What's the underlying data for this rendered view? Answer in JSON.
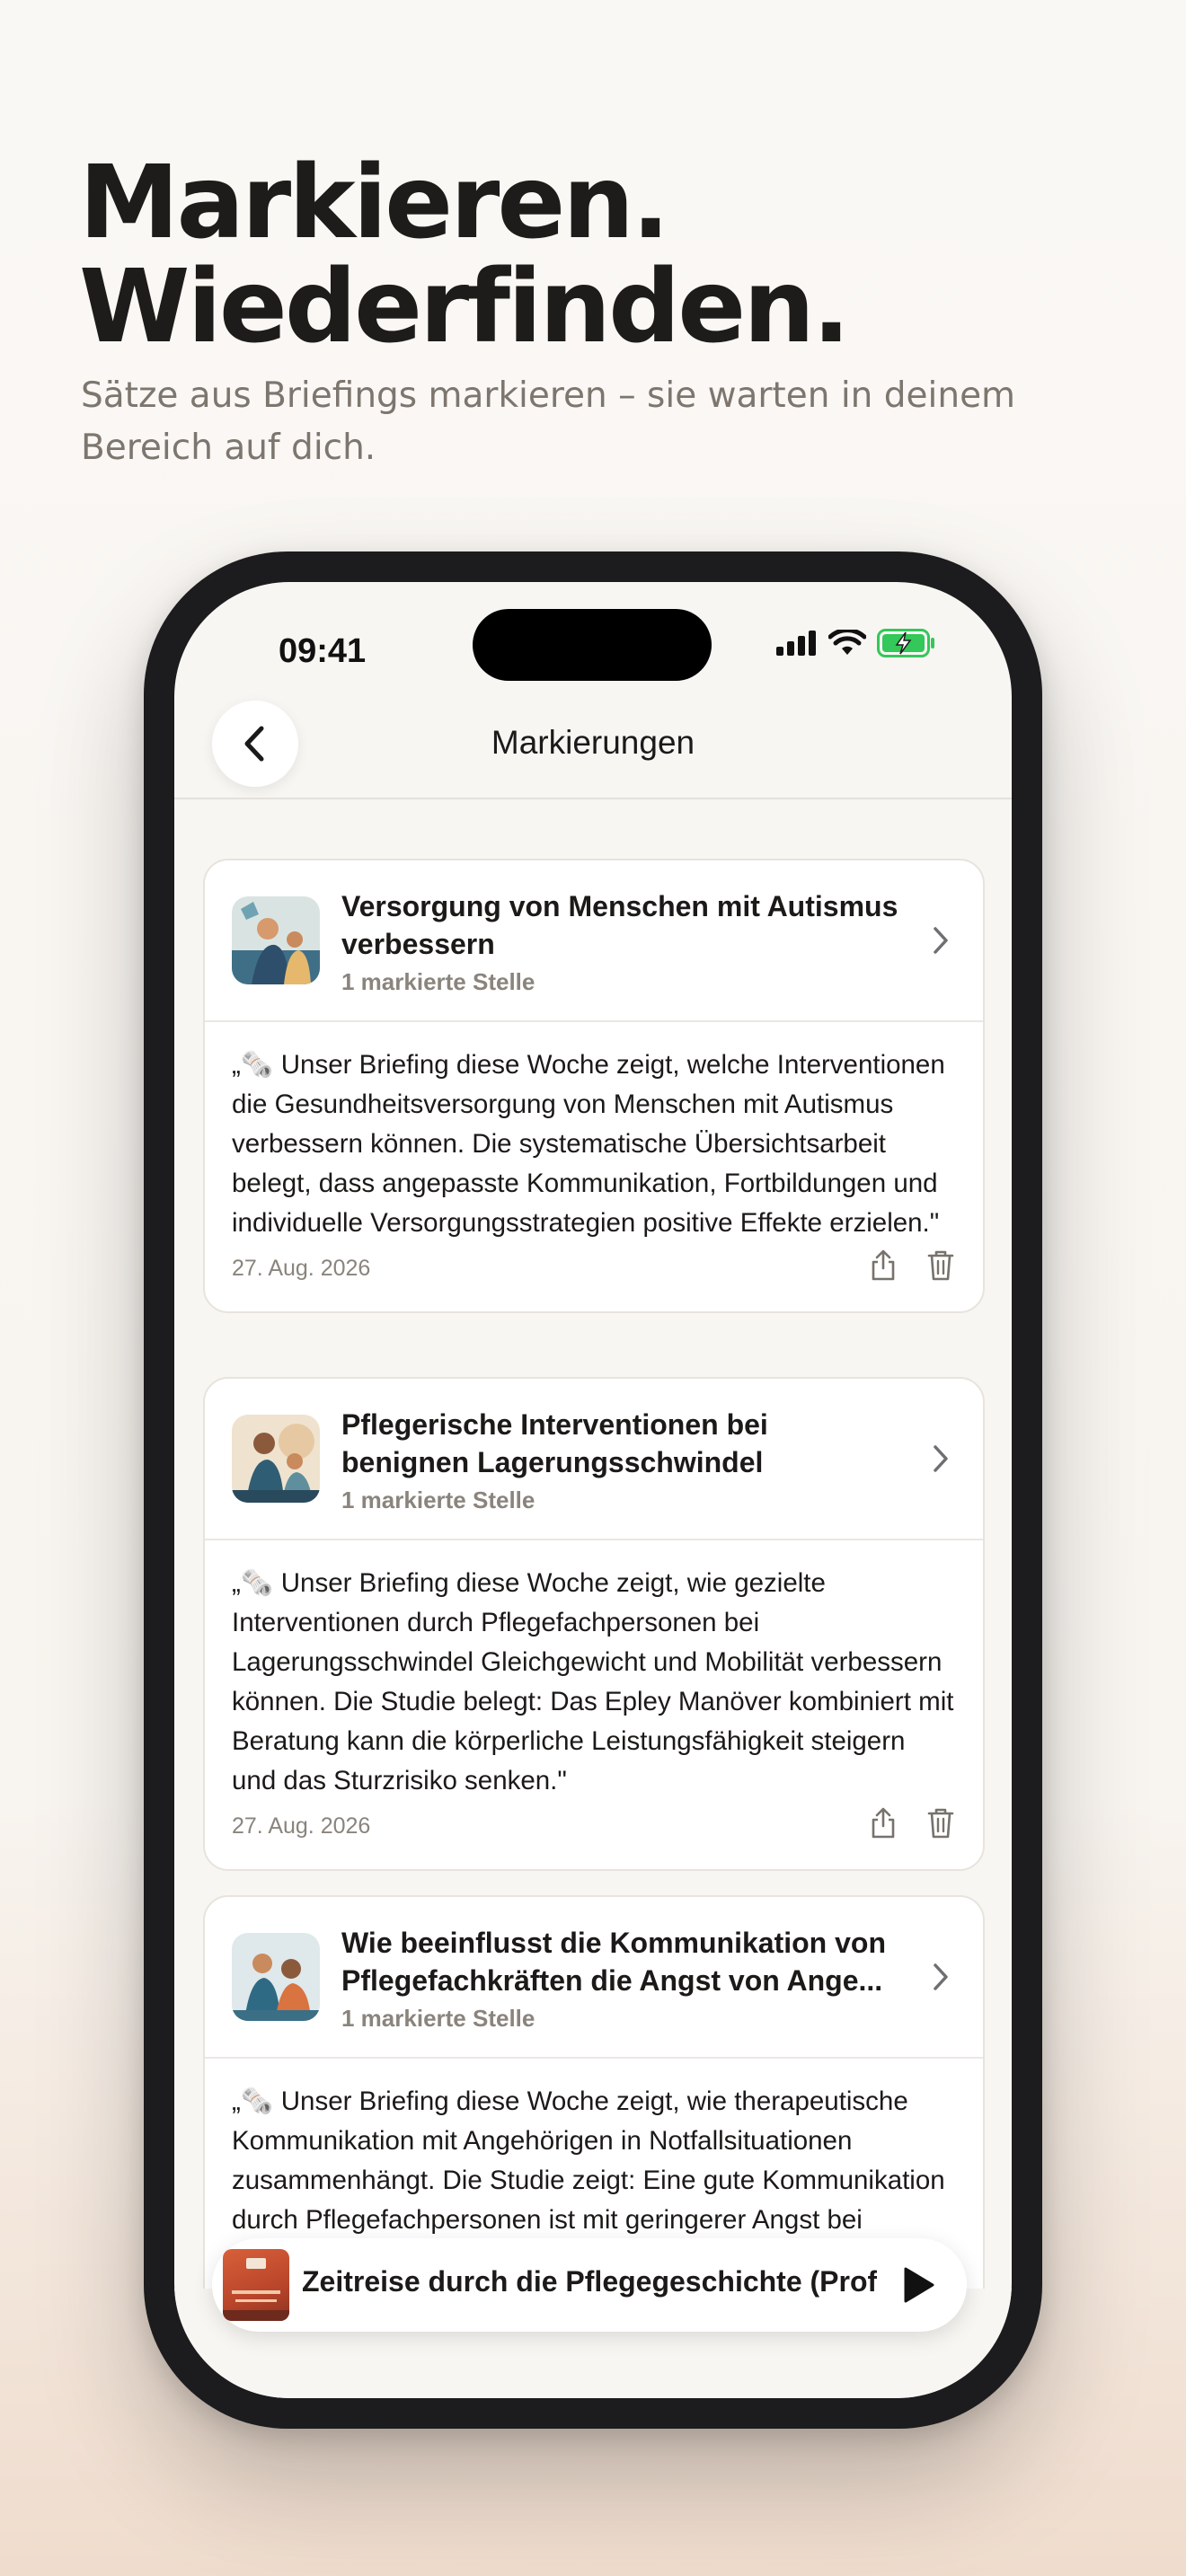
{
  "marketing": {
    "headline_line1": "Markieren.",
    "headline_line2": "Wiederfinden.",
    "subline": "Sätze aus Briefings markieren – sie warten in deinem Bereich auf dich."
  },
  "status_bar": {
    "time": "09:41"
  },
  "nav": {
    "title": "Markierungen",
    "back_icon": "chevron-left-icon"
  },
  "cards": [
    {
      "title_line1": "Versorgung von Menschen mit Autismus",
      "title_line2": "verbessern",
      "count": "1 markierte Stelle",
      "quote": "„🗞️ Unser Briefing diese Woche zeigt, welche Interventionen die Gesundheitsversorgung von Menschen mit Autismus verbessern können. Die systematische Übersichtsarbeit belegt, dass angepasste Kommunikation, Fortbildungen und individuelle Versorgungsstrategien positive Effekte erzielen.\"",
      "date": "27. Aug. 2026"
    },
    {
      "title_line1": "Pflegerische Interventionen bei",
      "title_line2": "benignen Lagerungsschwindel",
      "count": "1 markierte Stelle",
      "quote": "„🗞️ Unser Briefing diese Woche zeigt, wie gezielte Interventionen durch Pflegefachpersonen bei Lagerungsschwindel Gleichgewicht und Mobilität verbessern können. Die Studie belegt: Das Epley Manöver kombiniert mit Beratung kann die körperliche Leistungsfähigkeit steigern und das Sturzrisiko senken.\"",
      "date": "27. Aug. 2026"
    },
    {
      "title_line1": "Wie beeinflusst die Kommunikation von",
      "title_line2": "Pflegefachkräften die Angst von Ange...",
      "count": "1 markierte Stelle",
      "quote": "„🗞️ Unser Briefing diese Woche zeigt, wie therapeutische Kommunikation mit Angehörigen in Notfallsituationen zusammenhängt. Die Studie zeigt: Eine gute Kommunikation durch Pflegefachpersonen ist mit geringerer Angst bei Angehörigen verbunden.\""
    }
  ],
  "player": {
    "title": "Zeitreise durch die Pflegegeschichte (Prof",
    "play_icon": "play-icon"
  }
}
